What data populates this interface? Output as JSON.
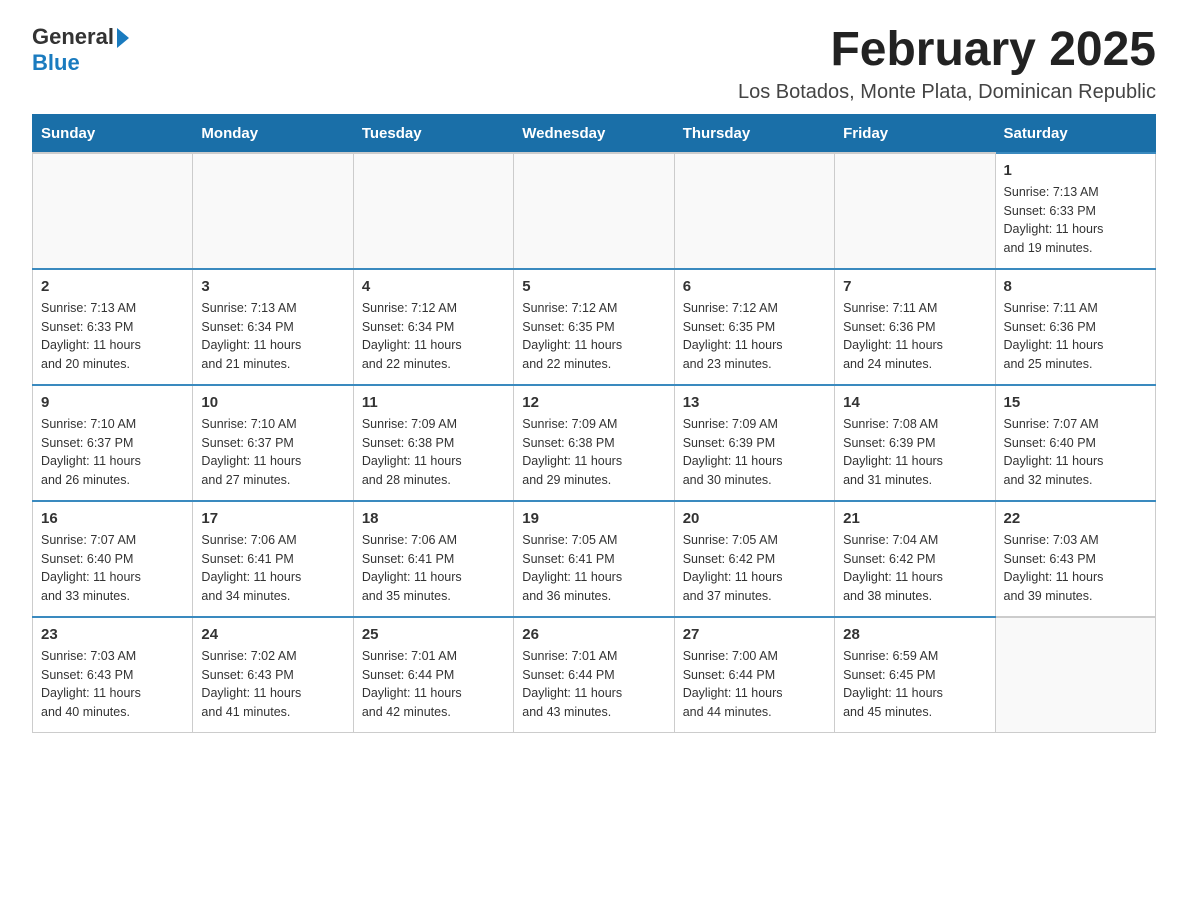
{
  "header": {
    "logo": {
      "general": "General",
      "blue": "Blue",
      "arrow": "►"
    },
    "title": "February 2025",
    "subtitle": "Los Botados, Monte Plata, Dominican Republic"
  },
  "weekdays": [
    "Sunday",
    "Monday",
    "Tuesday",
    "Wednesday",
    "Thursday",
    "Friday",
    "Saturday"
  ],
  "weeks": [
    {
      "days": [
        {
          "number": "",
          "info": ""
        },
        {
          "number": "",
          "info": ""
        },
        {
          "number": "",
          "info": ""
        },
        {
          "number": "",
          "info": ""
        },
        {
          "number": "",
          "info": ""
        },
        {
          "number": "",
          "info": ""
        },
        {
          "number": "1",
          "info": "Sunrise: 7:13 AM\nSunset: 6:33 PM\nDaylight: 11 hours\nand 19 minutes."
        }
      ]
    },
    {
      "days": [
        {
          "number": "2",
          "info": "Sunrise: 7:13 AM\nSunset: 6:33 PM\nDaylight: 11 hours\nand 20 minutes."
        },
        {
          "number": "3",
          "info": "Sunrise: 7:13 AM\nSunset: 6:34 PM\nDaylight: 11 hours\nand 21 minutes."
        },
        {
          "number": "4",
          "info": "Sunrise: 7:12 AM\nSunset: 6:34 PM\nDaylight: 11 hours\nand 22 minutes."
        },
        {
          "number": "5",
          "info": "Sunrise: 7:12 AM\nSunset: 6:35 PM\nDaylight: 11 hours\nand 22 minutes."
        },
        {
          "number": "6",
          "info": "Sunrise: 7:12 AM\nSunset: 6:35 PM\nDaylight: 11 hours\nand 23 minutes."
        },
        {
          "number": "7",
          "info": "Sunrise: 7:11 AM\nSunset: 6:36 PM\nDaylight: 11 hours\nand 24 minutes."
        },
        {
          "number": "8",
          "info": "Sunrise: 7:11 AM\nSunset: 6:36 PM\nDaylight: 11 hours\nand 25 minutes."
        }
      ]
    },
    {
      "days": [
        {
          "number": "9",
          "info": "Sunrise: 7:10 AM\nSunset: 6:37 PM\nDaylight: 11 hours\nand 26 minutes."
        },
        {
          "number": "10",
          "info": "Sunrise: 7:10 AM\nSunset: 6:37 PM\nDaylight: 11 hours\nand 27 minutes."
        },
        {
          "number": "11",
          "info": "Sunrise: 7:09 AM\nSunset: 6:38 PM\nDaylight: 11 hours\nand 28 minutes."
        },
        {
          "number": "12",
          "info": "Sunrise: 7:09 AM\nSunset: 6:38 PM\nDaylight: 11 hours\nand 29 minutes."
        },
        {
          "number": "13",
          "info": "Sunrise: 7:09 AM\nSunset: 6:39 PM\nDaylight: 11 hours\nand 30 minutes."
        },
        {
          "number": "14",
          "info": "Sunrise: 7:08 AM\nSunset: 6:39 PM\nDaylight: 11 hours\nand 31 minutes."
        },
        {
          "number": "15",
          "info": "Sunrise: 7:07 AM\nSunset: 6:40 PM\nDaylight: 11 hours\nand 32 minutes."
        }
      ]
    },
    {
      "days": [
        {
          "number": "16",
          "info": "Sunrise: 7:07 AM\nSunset: 6:40 PM\nDaylight: 11 hours\nand 33 minutes."
        },
        {
          "number": "17",
          "info": "Sunrise: 7:06 AM\nSunset: 6:41 PM\nDaylight: 11 hours\nand 34 minutes."
        },
        {
          "number": "18",
          "info": "Sunrise: 7:06 AM\nSunset: 6:41 PM\nDaylight: 11 hours\nand 35 minutes."
        },
        {
          "number": "19",
          "info": "Sunrise: 7:05 AM\nSunset: 6:41 PM\nDaylight: 11 hours\nand 36 minutes."
        },
        {
          "number": "20",
          "info": "Sunrise: 7:05 AM\nSunset: 6:42 PM\nDaylight: 11 hours\nand 37 minutes."
        },
        {
          "number": "21",
          "info": "Sunrise: 7:04 AM\nSunset: 6:42 PM\nDaylight: 11 hours\nand 38 minutes."
        },
        {
          "number": "22",
          "info": "Sunrise: 7:03 AM\nSunset: 6:43 PM\nDaylight: 11 hours\nand 39 minutes."
        }
      ]
    },
    {
      "days": [
        {
          "number": "23",
          "info": "Sunrise: 7:03 AM\nSunset: 6:43 PM\nDaylight: 11 hours\nand 40 minutes."
        },
        {
          "number": "24",
          "info": "Sunrise: 7:02 AM\nSunset: 6:43 PM\nDaylight: 11 hours\nand 41 minutes."
        },
        {
          "number": "25",
          "info": "Sunrise: 7:01 AM\nSunset: 6:44 PM\nDaylight: 11 hours\nand 42 minutes."
        },
        {
          "number": "26",
          "info": "Sunrise: 7:01 AM\nSunset: 6:44 PM\nDaylight: 11 hours\nand 43 minutes."
        },
        {
          "number": "27",
          "info": "Sunrise: 7:00 AM\nSunset: 6:44 PM\nDaylight: 11 hours\nand 44 minutes."
        },
        {
          "number": "28",
          "info": "Sunrise: 6:59 AM\nSunset: 6:45 PM\nDaylight: 11 hours\nand 45 minutes."
        },
        {
          "number": "",
          "info": ""
        }
      ]
    }
  ]
}
